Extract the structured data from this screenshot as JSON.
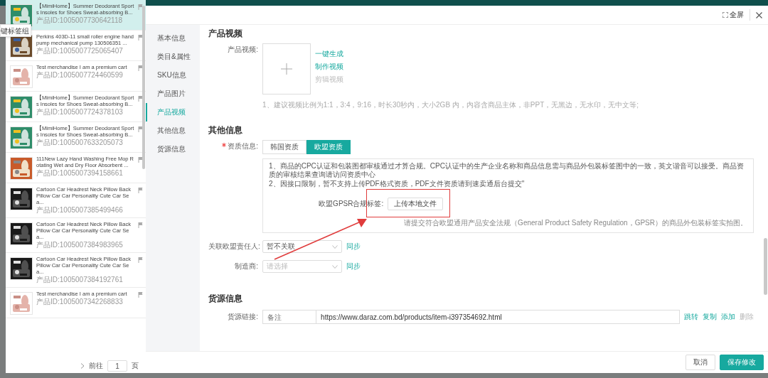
{
  "tooltip": {
    "text": "键标签组"
  },
  "products": [
    {
      "title": "【MimiHome】Summer Deodorant Sports Insoles for Shoes Sweat-absorbing B...",
      "product_id": "产品ID:1005007730642118",
      "selected": true
    },
    {
      "title": "Perkins 403D-11 small roller engine hand pump mechanical pump 130506351 ...",
      "product_id": "产品ID:1005007725065407",
      "selected": false
    },
    {
      "title": "Test merchandise I am a premium cart",
      "product_id": "产品ID:1005007724460599",
      "selected": false
    },
    {
      "title": "【MimiHome】Summer Deodorant Sports Insoles for Shoes Sweat-absorbing B...",
      "product_id": "产品ID:1005007724378103",
      "selected": false
    },
    {
      "title": "【MimiHome】Summer Deodorant Sports Insoles for Shoes Sweat-absorbing B...",
      "product_id": "产品ID:1005007633205073",
      "selected": false
    },
    {
      "title": "111New Lazy Hand Washing Free Mop Rotating Wet and Dry Floor Absorbent ...",
      "product_id": "产品ID:1005007394158661",
      "selected": false
    },
    {
      "title": "Cartoon Car Headrest Neck Pillow Back Pillow Car Car Personality Cute Car Sea...",
      "product_id": "产品ID:1005007385499466",
      "selected": false
    },
    {
      "title": "Cartoon Car Headrest Neck Pillow Back Pillow Car Car Personality Cute Car Sea...",
      "product_id": "产品ID:1005007384983965",
      "selected": false
    },
    {
      "title": "Cartoon Car Headrest Neck Pillow Back Pillow Car Car Personality Cute Car Sea...",
      "product_id": "产品ID:1005007384192761",
      "selected": false
    },
    {
      "title": "Test merchandise I am a premium cart",
      "product_id": "产品ID:1005007342268833",
      "selected": false
    }
  ],
  "pagination": {
    "goto_label": "前往",
    "page": "1",
    "page_suffix": "页"
  },
  "dialog": {
    "fullscreen_label": "全屏",
    "nav": [
      {
        "label": "基本信息",
        "selected": false
      },
      {
        "label": "类目&属性",
        "selected": false
      },
      {
        "label": "SKU信息",
        "selected": false
      },
      {
        "label": "产品图片",
        "selected": false
      },
      {
        "label": "产品视频",
        "selected": true
      },
      {
        "label": "其他信息",
        "selected": false
      },
      {
        "label": "货源信息",
        "selected": false
      }
    ],
    "video_section": {
      "title": "产品视频",
      "field_label": "产品视频:",
      "actions": [
        {
          "label": "一键生成",
          "disabled": false
        },
        {
          "label": "制作视频",
          "disabled": false
        },
        {
          "label": "剪辑视频",
          "disabled": true
        }
      ],
      "hint": "1、建议视频比例为1:1，3:4，9:16，时长30秒内，大小2GB 内，内容含商品主体，非PPT，无黑边，无水印，无中文等;"
    },
    "other_section": {
      "title": "其他信息",
      "qualification": {
        "label": "资质信息:",
        "required": true,
        "tabs": [
          {
            "label": "韩国资质",
            "selected": false
          },
          {
            "label": "欧盟资质",
            "selected": true
          }
        ],
        "notes": [
          "1、商品的CPC认证和包装图都审核通过才算合规。CPC认证中的生产企业名称和商品信息需与商品外包装标签图中的一致，英文谐音可以接受。商品资质的审核结果查询请访问资质中心",
          "2、因接口限制，暂不支持上传PDF格式资质，PDF文件资质请到速卖通后台提交\""
        ],
        "upload_label": "欧盟GPSR合规标签:",
        "upload_button": "上传本地文件",
        "upload_hint": "请提交符合欧盟通用产品安全法规（General Product Safety Regulation，GPSR）的商品外包装标签实拍图。"
      },
      "selects": [
        {
          "label": "关联欧盟责任人:",
          "value": "暂不关联",
          "link": "同步"
        },
        {
          "label": "制造商:",
          "placeholder": "请选择",
          "link": "同步"
        }
      ]
    },
    "source_section": {
      "title": "货源信息",
      "field_label": "货源链接:",
      "remark_placeholder": "备注",
      "url": "https://www.daraz.com.bd/products/item-i397354692.html",
      "actions": [
        {
          "label": "跳转",
          "disabled": false
        },
        {
          "label": "复制",
          "disabled": false
        },
        {
          "label": "添加",
          "disabled": false
        },
        {
          "label": "删除",
          "disabled": true
        }
      ]
    },
    "buttons": [
      {
        "label": "取消",
        "kind": "secondary"
      },
      {
        "label": "保存修改",
        "kind": "primary"
      }
    ]
  }
}
